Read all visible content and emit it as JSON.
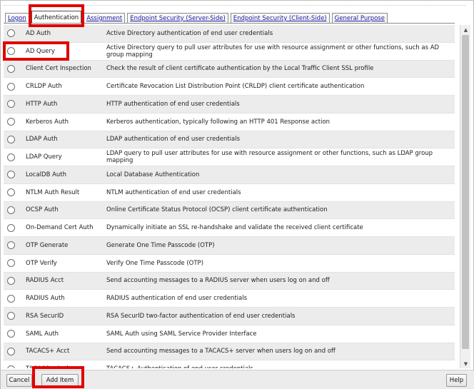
{
  "tabs": [
    {
      "label": "Logon",
      "active": false
    },
    {
      "label": "Authentication",
      "active": true
    },
    {
      "label": "Assignment",
      "active": false
    },
    {
      "label": "Endpoint Security (Server-Side)",
      "active": false
    },
    {
      "label": "Endpoint Security (Client-Side)",
      "active": false
    },
    {
      "label": "General Purpose",
      "active": false
    }
  ],
  "items": [
    {
      "name": "AD Auth",
      "description": "Active Directory authentication of end user credentials"
    },
    {
      "name": "AD Query",
      "description": "Active Directory query to pull user attributes for use with resource assignment or other functions, such as AD group mapping"
    },
    {
      "name": "Client Cert Inspection",
      "description": "Check the result of client certificate authentication by the Local Traffic Client SSL profile"
    },
    {
      "name": "CRLDP Auth",
      "description": "Certificate Revocation List Distribution Point (CRLDP) client certificate authentication"
    },
    {
      "name": "HTTP Auth",
      "description": "HTTP authentication of end user credentials"
    },
    {
      "name": "Kerberos Auth",
      "description": "Kerberos authentication, typically following an HTTP 401 Response action"
    },
    {
      "name": "LDAP Auth",
      "description": "LDAP authentication of end user credentials"
    },
    {
      "name": "LDAP Query",
      "description": "LDAP query to pull user attributes for use with resource assignment or other functions, such as LDAP group mapping"
    },
    {
      "name": "LocalDB Auth",
      "description": "Local Database Authentication"
    },
    {
      "name": "NTLM Auth Result",
      "description": "NTLM authentication of end user credentials"
    },
    {
      "name": "OCSP Auth",
      "description": "Online Certificate Status Protocol (OCSP) client certificate authentication"
    },
    {
      "name": "On-Demand Cert Auth",
      "description": "Dynamically initiate an SSL re-handshake and validate the received client certificate"
    },
    {
      "name": "OTP Generate",
      "description": "Generate One Time Passcode (OTP)"
    },
    {
      "name": "OTP Verify",
      "description": "Verify One Time Passcode (OTP)"
    },
    {
      "name": "RADIUS Acct",
      "description": "Send accounting messages to a RADIUS server when users log on and off"
    },
    {
      "name": "RADIUS Auth",
      "description": "RADIUS authentication of end user credentials"
    },
    {
      "name": "RSA SecurID",
      "description": "RSA SecurID two-factor authentication of end user credentials"
    },
    {
      "name": "SAML Auth",
      "description": "SAML Auth using SAML Service Provider Interface"
    },
    {
      "name": "TACACS+ Acct",
      "description": "Send accounting messages to a TACACS+ server when users log on and off"
    },
    {
      "name": "TACACS+ Auth",
      "description": "TACACS+ Authentication of end user credentials"
    }
  ],
  "buttons": {
    "cancel": "Cancel",
    "add_item": "Add Item",
    "help": "Help"
  },
  "colors": {
    "highlight": "#e00000",
    "tab_link": "#1a1a9e",
    "row_alt": "#ececec"
  }
}
